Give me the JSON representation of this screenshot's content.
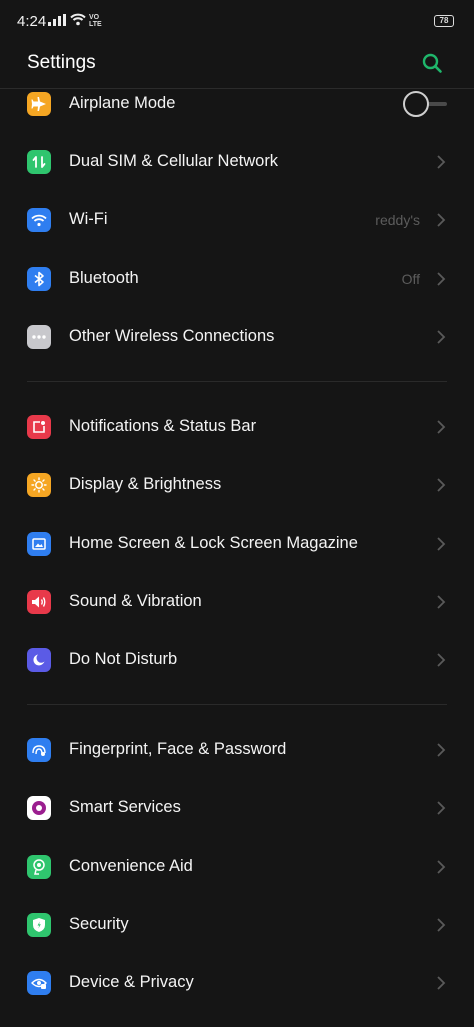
{
  "status": {
    "time": "4:24",
    "volte_top": "VO",
    "volte_bottom": "LTE",
    "battery": "78"
  },
  "header": {
    "title": "Settings"
  },
  "colors": {
    "accent": "#1fb66b"
  },
  "rows": [
    {
      "label": "Airplane Mode",
      "icon": "airplane-icon",
      "color": "#f5a623"
    },
    {
      "label": "Dual SIM & Cellular Network",
      "icon": "sim-icon",
      "color": "#2fc56e"
    },
    {
      "label": "Wi-Fi",
      "value": "reddy's",
      "icon": "wifi-icon",
      "color": "#2f7ef0"
    },
    {
      "label": "Bluetooth",
      "value": "Off",
      "icon": "bluetooth-icon",
      "color": "#2f7ef0"
    },
    {
      "label": "Other Wireless Connections",
      "icon": "more-icon",
      "color": "#c8c8cc"
    },
    {
      "label": "Notifications & Status Bar",
      "icon": "notification-icon",
      "color": "#e8394a"
    },
    {
      "label": "Display & Brightness",
      "icon": "brightness-icon",
      "color": "#f5a623"
    },
    {
      "label": "Home Screen & Lock Screen Magazine",
      "icon": "wallpaper-icon",
      "color": "#2f7ef0"
    },
    {
      "label": "Sound & Vibration",
      "icon": "sound-icon",
      "color": "#e8394a"
    },
    {
      "label": "Do Not Disturb",
      "icon": "moon-icon",
      "color": "#5b5be6"
    },
    {
      "label": "Fingerprint, Face & Password",
      "icon": "fingerprint-icon",
      "color": "#2f7ef0"
    },
    {
      "label": "Smart Services",
      "icon": "smart-services-icon",
      "color": "#ffffff"
    },
    {
      "label": "Convenience Aid",
      "icon": "convenience-icon",
      "color": "#2fc56e"
    },
    {
      "label": "Security",
      "icon": "shield-icon",
      "color": "#2fc56e"
    },
    {
      "label": "Device & Privacy",
      "icon": "privacy-icon",
      "color": "#2f7ef0"
    }
  ]
}
